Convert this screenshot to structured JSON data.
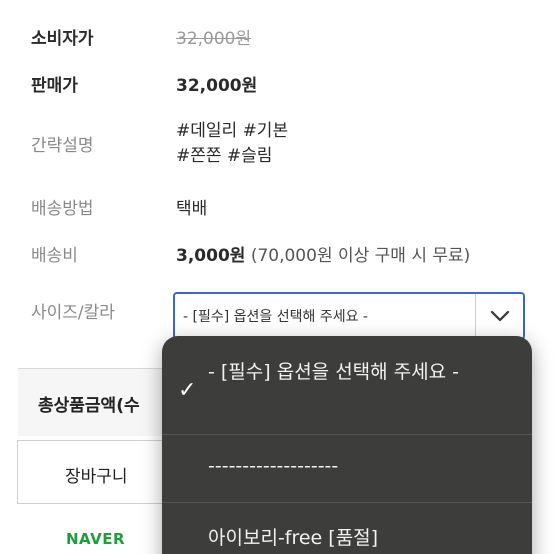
{
  "rows": {
    "consumer_price": {
      "label": "소비자가",
      "value": "32,000원"
    },
    "sale_price": {
      "label": "판매가",
      "value": "32,000원"
    },
    "description": {
      "label": "간략설명",
      "line1": "#데일리 #기본",
      "line2": "#쫀쫀 #슬림"
    },
    "shipping_method": {
      "label": "배송방법",
      "value": "택배"
    },
    "shipping_fee": {
      "label": "배송비",
      "value": "3,000원",
      "note": "(70,000원 이상 구매 시 무료)"
    },
    "option": {
      "label": "사이즈/칼라",
      "selected": "- [필수] 옵션을 선택해 주세요 -"
    }
  },
  "total_label": "총상품금액(수",
  "cart_label": "장바구니",
  "naver_label": "NAVER",
  "dropdown": {
    "options": [
      {
        "label": "- [필수] 옵션을 선택해 주세요 -",
        "selected": true
      },
      {
        "label": "-------------------",
        "selected": false
      },
      {
        "label": "아이보리-free [품절]",
        "selected": false
      }
    ]
  },
  "colors": {
    "accent": "#3b66d6",
    "dropdown_bg": "#3d3d3c",
    "naver_green": "#1e9e3a"
  },
  "icons": {
    "select_arrow": "chevron-down-icon",
    "selected_mark": "checkmark-icon"
  }
}
